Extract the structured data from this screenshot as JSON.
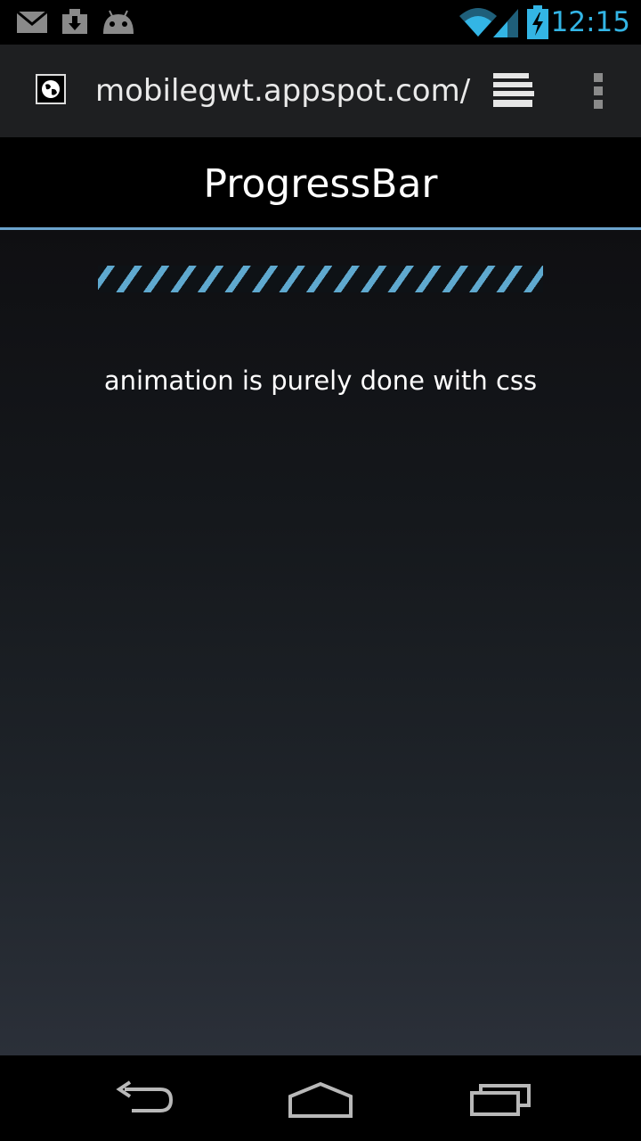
{
  "status_bar": {
    "left_icons": [
      "gmail-icon",
      "download-icon",
      "android-icon"
    ],
    "right_icons": [
      "wifi-icon",
      "signal-icon",
      "battery-charging-icon"
    ],
    "time": "12:15",
    "accent_color": "#33b5e5"
  },
  "browser": {
    "url": "mobilegwt.appspot.com/",
    "favicon": "globe-icon",
    "tabs_icon": "tabs-icon",
    "menu_icon": "overflow-menu-icon"
  },
  "page": {
    "title": "ProgressBar",
    "header_rule_color": "#6ba3cc",
    "progress": {
      "state": "indeterminate",
      "stripe_color": "#5fa9cf",
      "value_fraction": 1.0
    },
    "caption": "animation is purely done with css"
  },
  "nav_bar": {
    "buttons": [
      "back-icon",
      "home-icon",
      "recent-apps-icon"
    ]
  }
}
